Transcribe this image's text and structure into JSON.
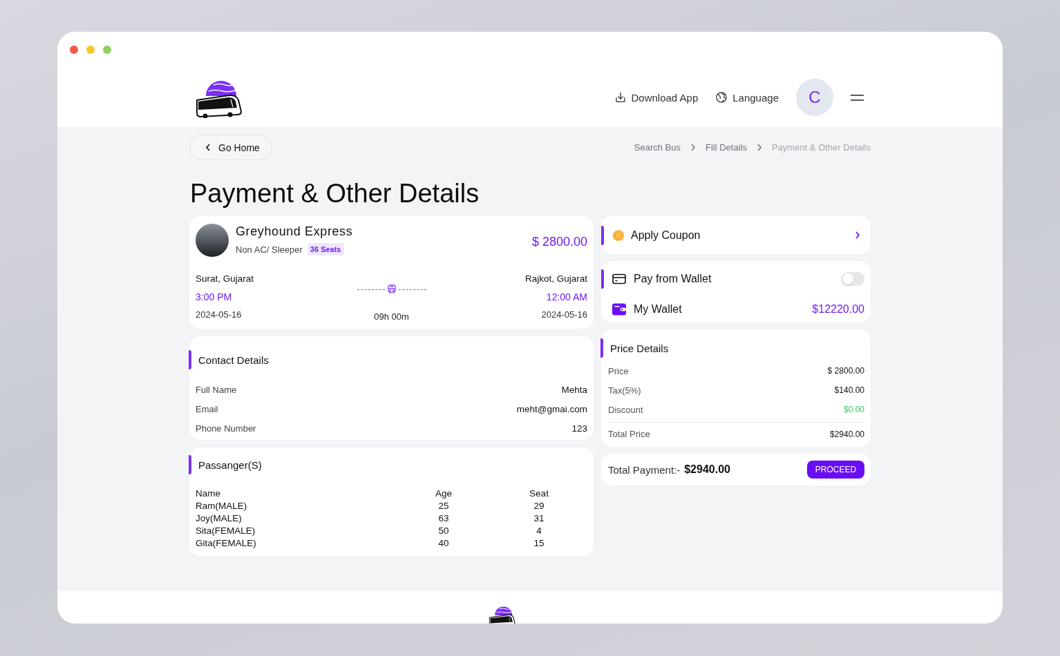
{
  "header": {
    "nav": [
      {
        "kind": "download",
        "label": "Download App"
      },
      {
        "kind": "language",
        "label": "Language"
      }
    ],
    "avatar": {
      "initial": "C"
    }
  },
  "breadcrumb": {
    "back": "Go Home",
    "items": [
      {
        "label": "Search Bus",
        "current": false
      },
      {
        "label": "Fill Details",
        "current": false
      },
      {
        "label": "Payment & Other Details",
        "current": true
      }
    ]
  },
  "title": "Payment & Other Details",
  "trip": {
    "operator": "Greyhound Express",
    "bus_type": "Non AC/ Sleeper",
    "seats": "36 Seats",
    "price": "$ 2800.00",
    "from": {
      "city": "Surat, Gujarat",
      "time": "3:00 PM",
      "date": "2024-05-16"
    },
    "to": {
      "city": "Rajkot, Gujarat",
      "time": "12:00 AM",
      "date": "2024-05-16"
    },
    "duration": "09h 00m"
  },
  "contact": {
    "title": "Contact Details",
    "fields": [
      {
        "label": "Full Name",
        "value": "Mehta"
      },
      {
        "label": "Email",
        "value": "meht@gmai.com"
      },
      {
        "label": "Phone Number",
        "value": "123"
      }
    ]
  },
  "passengers": {
    "title": "Passanger(S)",
    "columns": [
      "Name",
      "Age",
      "Seat"
    ],
    "rows": [
      [
        "Ram(MALE)",
        "25",
        "29"
      ],
      [
        "Joy(MALE)",
        "63",
        "31"
      ],
      [
        "Sita(FEMALE)",
        "50",
        "4"
      ],
      [
        "Gita(FEMALE)",
        "40",
        "15"
      ]
    ]
  },
  "coupon": {
    "label": "Apply Coupon"
  },
  "wallet": {
    "label": "Pay from Wallet",
    "on": false,
    "balance_label": "My Wallet",
    "balance": "$12220.00"
  },
  "price_details": {
    "title": "Price Details",
    "rows": [
      {
        "kind": "item",
        "label": "Price",
        "value": "$ 2800.00",
        "color": "#111111"
      },
      {
        "kind": "item",
        "label": "Tax(5%)",
        "value": "$140.00",
        "color": "#111111"
      },
      {
        "kind": "item",
        "label": "Discount",
        "value": "$0.00",
        "color": "#34c759"
      },
      {
        "kind": "total",
        "label": "Total Price",
        "value": "$2940.00",
        "color": "#111111"
      }
    ]
  },
  "total": {
    "label": "Total Payment:-",
    "amount": "$2940.00",
    "button": "PROCEED"
  }
}
